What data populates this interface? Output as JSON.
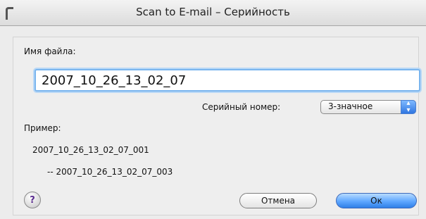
{
  "window": {
    "title": "Scan to E-mail – Серийность"
  },
  "form": {
    "file_name_label": "Имя файла:",
    "file_name_value": "2007_10_26_13_02_07",
    "serial_label": "Серийный номер:",
    "serial_selected": "3-значное",
    "example_label": "Пример:",
    "example_first": "2007_10_26_13_02_07_001",
    "example_last": "--   2007_10_26_13_02_07_003"
  },
  "buttons": {
    "help": "?",
    "cancel": "Отмена",
    "ok": "Ок"
  },
  "icons": {
    "select_arrows": "up-down-arrows-icon",
    "help": "help-icon"
  },
  "colors": {
    "accent": "#2f7fe7",
    "focus_ring": "#7ab5ee"
  }
}
